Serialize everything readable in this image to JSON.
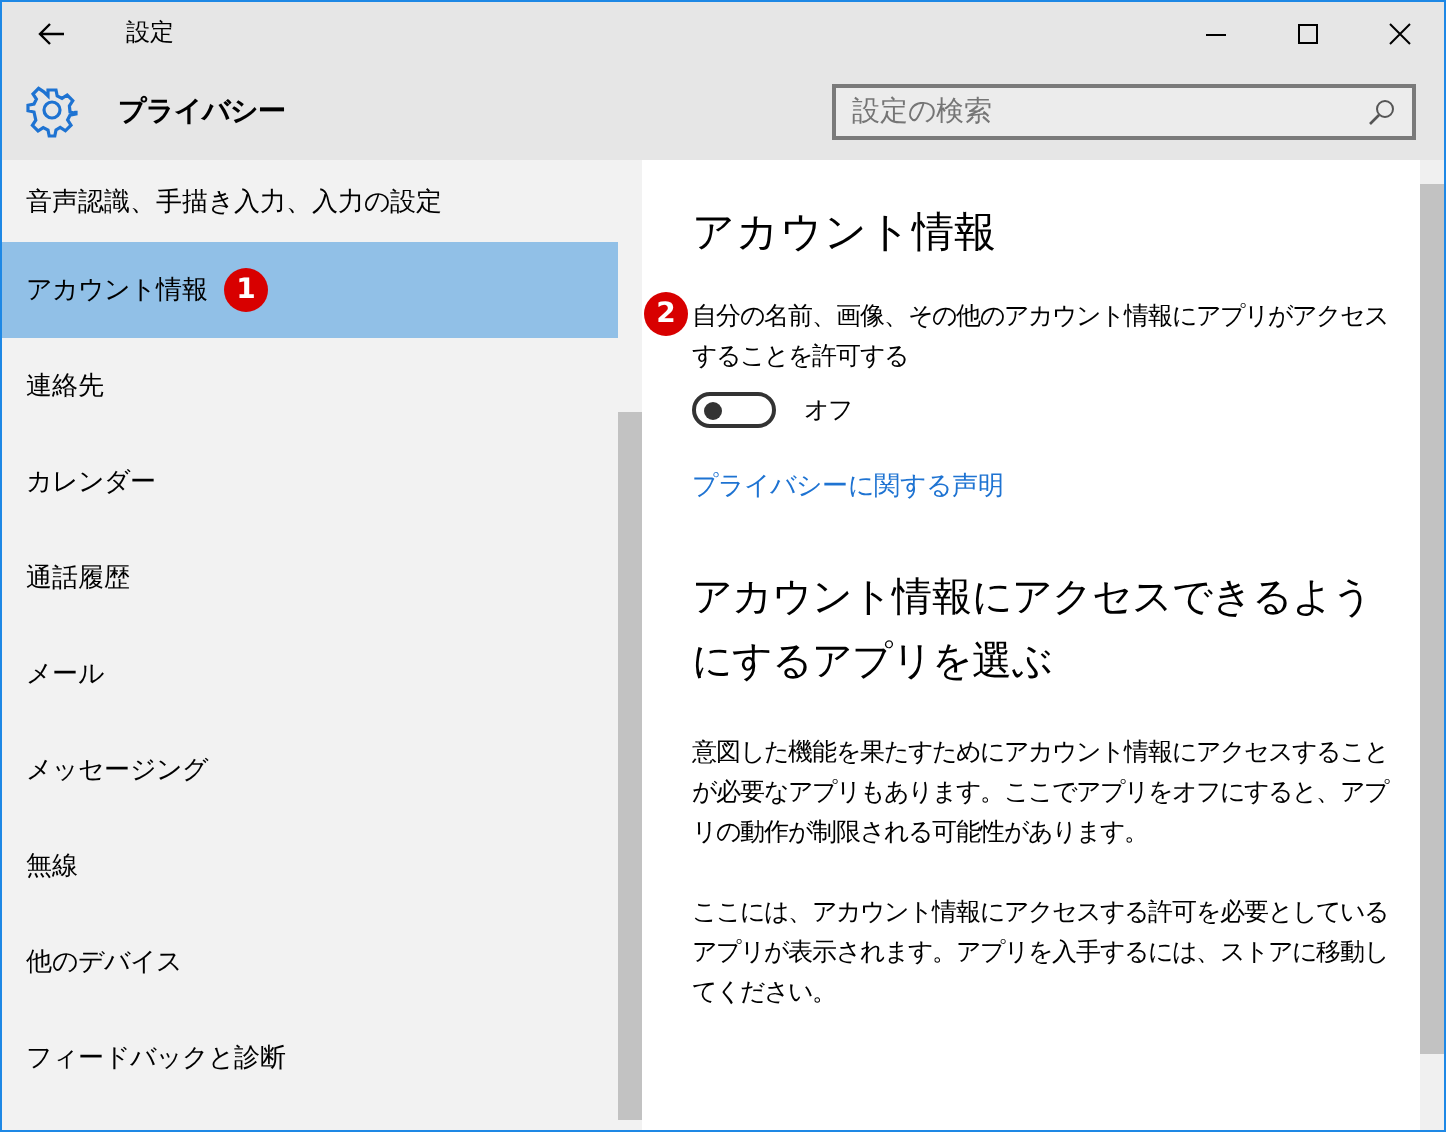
{
  "window": {
    "title": "設定"
  },
  "header": {
    "title": "プライバシー",
    "search": {
      "placeholder": "設定の検索"
    }
  },
  "sidebar": {
    "items": [
      {
        "label": "音声認識、手描き入力、入力の設定",
        "selected": false
      },
      {
        "label": "アカウント情報",
        "selected": true,
        "badge": "1"
      },
      {
        "label": "連絡先",
        "selected": false
      },
      {
        "label": "カレンダー",
        "selected": false
      },
      {
        "label": "通話履歴",
        "selected": false
      },
      {
        "label": "メール",
        "selected": false
      },
      {
        "label": "メッセージング",
        "selected": false
      },
      {
        "label": "無線",
        "selected": false
      },
      {
        "label": "他のデバイス",
        "selected": false
      },
      {
        "label": "フィードバックと診断",
        "selected": false
      }
    ]
  },
  "content": {
    "title": "アカウント情報",
    "setting": {
      "badge": "2",
      "label": "自分の名前、画像、その他のアカウント情報にアプリがアクセスすることを許可する",
      "toggle": {
        "on": false,
        "label": "オフ"
      }
    },
    "link": "プライバシーに関する声明",
    "section_title": "アカウント情報にアクセスできるようにするアプリを選ぶ",
    "paragraphs": [
      "意図した機能を果たすためにアカウント情報にアクセスすることが必要なアプリもあります。ここでアプリをオフにすると、アプリの動作が制限される可能性があります。",
      "ここには、アカウント情報にアクセスする許可を必要としているアプリが表示されます。アプリを入手するには、ストアに移動してください。"
    ]
  }
}
